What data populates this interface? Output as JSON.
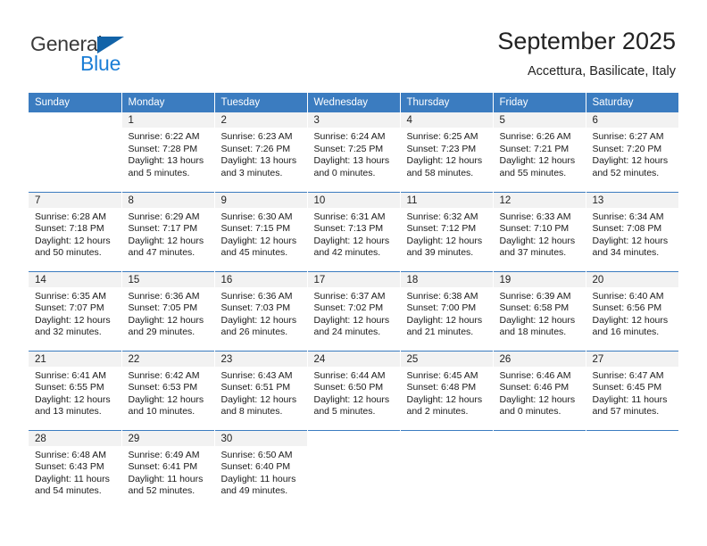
{
  "brand": {
    "name_part1": "General",
    "name_part2": "Blue",
    "triangle_icon": "triangle-icon",
    "colors": {
      "dark": "#3a3a3a",
      "blue": "#1b7ed6",
      "triangle": "#1263a8"
    }
  },
  "header": {
    "title": "September 2025",
    "subtitle": "Accettura, Basilicate, Italy"
  },
  "theme": {
    "header_bg": "#3b7cc0",
    "header_text": "#ffffff",
    "daynum_band_bg": "#f2f2f2",
    "row_divider": "#3b7cc0"
  },
  "weekday_headers": [
    "Sunday",
    "Monday",
    "Tuesday",
    "Wednesday",
    "Thursday",
    "Friday",
    "Saturday"
  ],
  "weeks": [
    {
      "days": [
        {
          "day": "",
          "lines": []
        },
        {
          "day": "1",
          "lines": [
            "Sunrise: 6:22 AM",
            "Sunset: 7:28 PM",
            "Daylight: 13 hours",
            "and 5 minutes."
          ]
        },
        {
          "day": "2",
          "lines": [
            "Sunrise: 6:23 AM",
            "Sunset: 7:26 PM",
            "Daylight: 13 hours",
            "and 3 minutes."
          ]
        },
        {
          "day": "3",
          "lines": [
            "Sunrise: 6:24 AM",
            "Sunset: 7:25 PM",
            "Daylight: 13 hours",
            "and 0 minutes."
          ]
        },
        {
          "day": "4",
          "lines": [
            "Sunrise: 6:25 AM",
            "Sunset: 7:23 PM",
            "Daylight: 12 hours",
            "and 58 minutes."
          ]
        },
        {
          "day": "5",
          "lines": [
            "Sunrise: 6:26 AM",
            "Sunset: 7:21 PM",
            "Daylight: 12 hours",
            "and 55 minutes."
          ]
        },
        {
          "day": "6",
          "lines": [
            "Sunrise: 6:27 AM",
            "Sunset: 7:20 PM",
            "Daylight: 12 hours",
            "and 52 minutes."
          ]
        }
      ]
    },
    {
      "days": [
        {
          "day": "7",
          "lines": [
            "Sunrise: 6:28 AM",
            "Sunset: 7:18 PM",
            "Daylight: 12 hours",
            "and 50 minutes."
          ]
        },
        {
          "day": "8",
          "lines": [
            "Sunrise: 6:29 AM",
            "Sunset: 7:17 PM",
            "Daylight: 12 hours",
            "and 47 minutes."
          ]
        },
        {
          "day": "9",
          "lines": [
            "Sunrise: 6:30 AM",
            "Sunset: 7:15 PM",
            "Daylight: 12 hours",
            "and 45 minutes."
          ]
        },
        {
          "day": "10",
          "lines": [
            "Sunrise: 6:31 AM",
            "Sunset: 7:13 PM",
            "Daylight: 12 hours",
            "and 42 minutes."
          ]
        },
        {
          "day": "11",
          "lines": [
            "Sunrise: 6:32 AM",
            "Sunset: 7:12 PM",
            "Daylight: 12 hours",
            "and 39 minutes."
          ]
        },
        {
          "day": "12",
          "lines": [
            "Sunrise: 6:33 AM",
            "Sunset: 7:10 PM",
            "Daylight: 12 hours",
            "and 37 minutes."
          ]
        },
        {
          "day": "13",
          "lines": [
            "Sunrise: 6:34 AM",
            "Sunset: 7:08 PM",
            "Daylight: 12 hours",
            "and 34 minutes."
          ]
        }
      ]
    },
    {
      "days": [
        {
          "day": "14",
          "lines": [
            "Sunrise: 6:35 AM",
            "Sunset: 7:07 PM",
            "Daylight: 12 hours",
            "and 32 minutes."
          ]
        },
        {
          "day": "15",
          "lines": [
            "Sunrise: 6:36 AM",
            "Sunset: 7:05 PM",
            "Daylight: 12 hours",
            "and 29 minutes."
          ]
        },
        {
          "day": "16",
          "lines": [
            "Sunrise: 6:36 AM",
            "Sunset: 7:03 PM",
            "Daylight: 12 hours",
            "and 26 minutes."
          ]
        },
        {
          "day": "17",
          "lines": [
            "Sunrise: 6:37 AM",
            "Sunset: 7:02 PM",
            "Daylight: 12 hours",
            "and 24 minutes."
          ]
        },
        {
          "day": "18",
          "lines": [
            "Sunrise: 6:38 AM",
            "Sunset: 7:00 PM",
            "Daylight: 12 hours",
            "and 21 minutes."
          ]
        },
        {
          "day": "19",
          "lines": [
            "Sunrise: 6:39 AM",
            "Sunset: 6:58 PM",
            "Daylight: 12 hours",
            "and 18 minutes."
          ]
        },
        {
          "day": "20",
          "lines": [
            "Sunrise: 6:40 AM",
            "Sunset: 6:56 PM",
            "Daylight: 12 hours",
            "and 16 minutes."
          ]
        }
      ]
    },
    {
      "days": [
        {
          "day": "21",
          "lines": [
            "Sunrise: 6:41 AM",
            "Sunset: 6:55 PM",
            "Daylight: 12 hours",
            "and 13 minutes."
          ]
        },
        {
          "day": "22",
          "lines": [
            "Sunrise: 6:42 AM",
            "Sunset: 6:53 PM",
            "Daylight: 12 hours",
            "and 10 minutes."
          ]
        },
        {
          "day": "23",
          "lines": [
            "Sunrise: 6:43 AM",
            "Sunset: 6:51 PM",
            "Daylight: 12 hours",
            "and 8 minutes."
          ]
        },
        {
          "day": "24",
          "lines": [
            "Sunrise: 6:44 AM",
            "Sunset: 6:50 PM",
            "Daylight: 12 hours",
            "and 5 minutes."
          ]
        },
        {
          "day": "25",
          "lines": [
            "Sunrise: 6:45 AM",
            "Sunset: 6:48 PM",
            "Daylight: 12 hours",
            "and 2 minutes."
          ]
        },
        {
          "day": "26",
          "lines": [
            "Sunrise: 6:46 AM",
            "Sunset: 6:46 PM",
            "Daylight: 12 hours",
            "and 0 minutes."
          ]
        },
        {
          "day": "27",
          "lines": [
            "Sunrise: 6:47 AM",
            "Sunset: 6:45 PM",
            "Daylight: 11 hours",
            "and 57 minutes."
          ]
        }
      ]
    },
    {
      "days": [
        {
          "day": "28",
          "lines": [
            "Sunrise: 6:48 AM",
            "Sunset: 6:43 PM",
            "Daylight: 11 hours",
            "and 54 minutes."
          ]
        },
        {
          "day": "29",
          "lines": [
            "Sunrise: 6:49 AM",
            "Sunset: 6:41 PM",
            "Daylight: 11 hours",
            "and 52 minutes."
          ]
        },
        {
          "day": "30",
          "lines": [
            "Sunrise: 6:50 AM",
            "Sunset: 6:40 PM",
            "Daylight: 11 hours",
            "and 49 minutes."
          ]
        },
        {
          "day": "",
          "lines": []
        },
        {
          "day": "",
          "lines": []
        },
        {
          "day": "",
          "lines": []
        },
        {
          "day": "",
          "lines": []
        }
      ]
    }
  ]
}
